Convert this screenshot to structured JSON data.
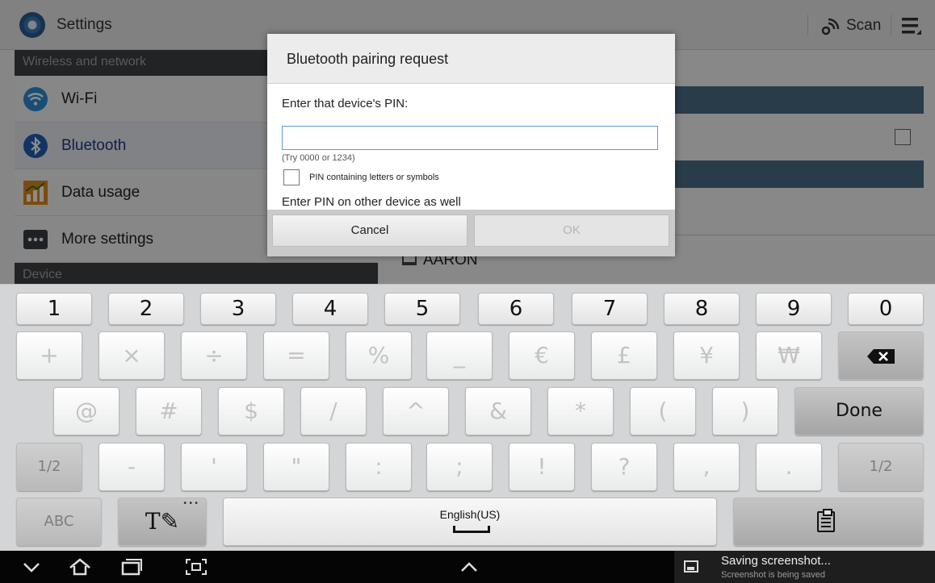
{
  "actionbar": {
    "title": "Settings",
    "scan_label": "Scan"
  },
  "left_pane": {
    "section_wireless": "Wireless and network",
    "items": [
      {
        "label": "Wi-Fi",
        "icon": "wifi-icon"
      },
      {
        "label": "Bluetooth",
        "icon": "bluetooth-icon",
        "selected": true
      },
      {
        "label": "Data usage",
        "icon": "data-usage-icon"
      },
      {
        "label": "More settings",
        "icon": "more-settings-icon"
      }
    ],
    "section_device": "Device"
  },
  "right_pane": {
    "device_name": "AARON"
  },
  "dialog": {
    "title": "Bluetooth pairing request",
    "prompt": "Enter that device's PIN:",
    "pin_value": "",
    "hint": "(Try 0000 or 1234)",
    "checkbox_label": "PIN containing letters or symbols",
    "note": "Enter PIN on other device as well",
    "cancel_label": "Cancel",
    "ok_label": "OK"
  },
  "keyboard": {
    "row_numbers": [
      "1",
      "2",
      "3",
      "4",
      "5",
      "6",
      "7",
      "8",
      "9",
      "0"
    ],
    "row2": [
      "+",
      "×",
      "÷",
      "=",
      "%",
      "_",
      "€",
      "£",
      "¥",
      "₩"
    ],
    "row3": [
      "@",
      "#",
      "$",
      "/",
      "^",
      "&",
      "*",
      "(",
      ")"
    ],
    "done_label": "Done",
    "row4_left": "1/2",
    "row4": [
      "-",
      "'",
      "\"",
      ":",
      ";",
      "!",
      "?",
      ",",
      "."
    ],
    "row4_right": "1/2",
    "abc_label": "ABC",
    "handwriting_label": "T",
    "space_label": "English(US)"
  },
  "notification": {
    "title": "Saving screenshot...",
    "subtitle": "Screenshot is being saved"
  },
  "colors": {
    "section_header": "#3d4144",
    "accent_blue": "#5b9bd5",
    "pane_bar": "#4a6e87"
  }
}
